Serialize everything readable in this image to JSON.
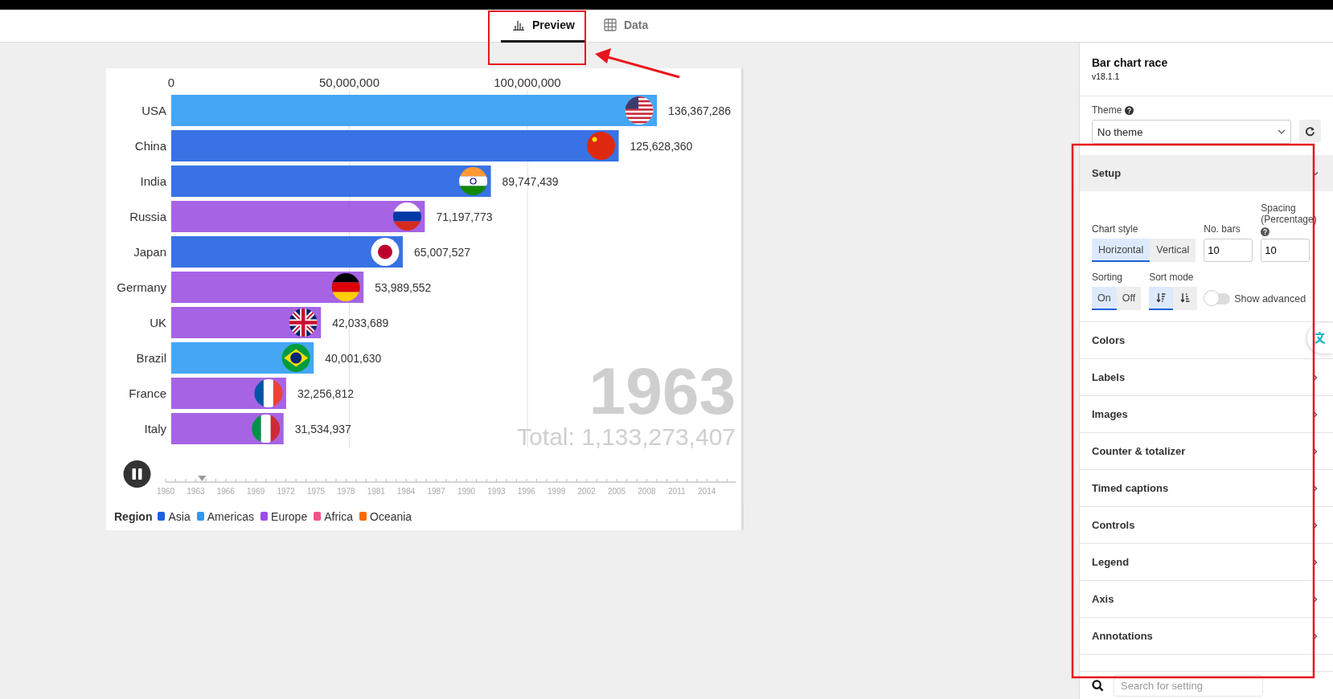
{
  "tabs": [
    {
      "label": "Preview",
      "selected": true
    },
    {
      "label": "Data",
      "selected": false
    }
  ],
  "chart": {
    "chart_data": {
      "type": "bar",
      "orientation": "horizontal",
      "categories": [
        "USA",
        "China",
        "India",
        "Russia",
        "Japan",
        "Germany",
        "UK",
        "Brazil",
        "France",
        "Italy"
      ],
      "series": [
        {
          "name": "Asia",
          "color": "#1d5fe0",
          "values": [
            null,
            125628360,
            89747439,
            null,
            65007527,
            null,
            null,
            null,
            null,
            null
          ]
        },
        {
          "name": "Americas",
          "color": "#2b9af3",
          "values": [
            136367286,
            null,
            null,
            null,
            null,
            null,
            null,
            40001630,
            null,
            null
          ]
        },
        {
          "name": "Europe",
          "color": "#9a4fe0",
          "values": [
            null,
            null,
            null,
            71197773,
            null,
            53989552,
            42033689,
            null,
            32256812,
            31534937
          ]
        },
        {
          "name": "Africa",
          "color": "#f2528b",
          "values": [
            null,
            null,
            null,
            null,
            null,
            null,
            null,
            null,
            null,
            null
          ]
        },
        {
          "name": "Oceania",
          "color": "#f56a00",
          "values": [
            null,
            null,
            null,
            null,
            null,
            null,
            null,
            null,
            null,
            null
          ]
        }
      ],
      "value_labels": [
        "136,367,286",
        "125,628,360",
        "89,747,439",
        "71,197,773",
        "65,007,527",
        "53,989,552",
        "42,033,689",
        "40,001,630",
        "32,256,812",
        "31,534,937"
      ],
      "xlim": [
        0,
        160000000
      ],
      "xticks": [
        {
          "value": 0,
          "label": "0"
        },
        {
          "value": 50000000,
          "label": "50,000,000"
        },
        {
          "value": 100000000,
          "label": "100,000,000"
        }
      ]
    },
    "counter": "1963",
    "total": "Total: 1,133,273,407",
    "playing": true,
    "timeline": {
      "level": 0.064,
      "labels": [
        "1960",
        "1963",
        "1966",
        "1969",
        "1972",
        "1975",
        "1978",
        "1981",
        "1984",
        "1987",
        "1990",
        "1993",
        "1996",
        "1999",
        "2002",
        "2005",
        "2008",
        "2011",
        "2014"
      ]
    },
    "legend": {
      "title": "Region"
    }
  },
  "panel": {
    "title": "Bar chart race",
    "version": "v18.1.1",
    "theme": {
      "label": "Theme",
      "value": "No theme"
    },
    "setup": {
      "title": "Setup",
      "expanded": true,
      "chart_style": {
        "label": "Chart style",
        "options": [
          {
            "label": "Horizontal",
            "selected": true
          },
          {
            "label": "Vertical",
            "selected": false
          }
        ]
      },
      "no_bars": {
        "label": "No. bars",
        "value": "10"
      },
      "spacing": {
        "label": "Spacing (Percentage)",
        "value": "10"
      },
      "sorting": {
        "label": "Sorting",
        "options": [
          {
            "label": "On",
            "selected": true
          },
          {
            "label": "Off",
            "selected": false
          }
        ]
      },
      "sort_mode": {
        "label": "Sort mode",
        "options": [
          {
            "selected": true
          },
          {
            "selected": false
          }
        ]
      },
      "show_advanced": {
        "label": "Show advanced",
        "on": false
      }
    },
    "sections": [
      {
        "title": "Colors",
        "expanded": false
      },
      {
        "title": "Labels",
        "expanded": false
      },
      {
        "title": "Images",
        "expanded": false
      },
      {
        "title": "Counter & totalizer",
        "expanded": false
      },
      {
        "title": "Timed captions",
        "expanded": false
      },
      {
        "title": "Controls",
        "expanded": false
      },
      {
        "title": "Legend",
        "expanded": false
      },
      {
        "title": "Axis",
        "expanded": false
      },
      {
        "title": "Annotations",
        "expanded": false
      }
    ],
    "search": {
      "placeholder": "Search for setting"
    }
  }
}
